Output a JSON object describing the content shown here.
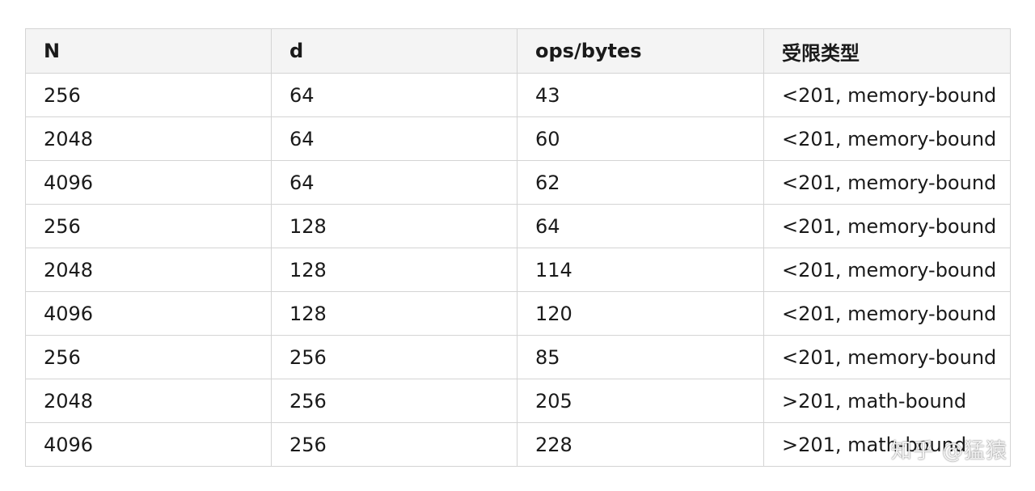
{
  "table": {
    "headers": [
      "N",
      "d",
      "ops/bytes",
      "受限类型"
    ],
    "rows": [
      [
        "256",
        "64",
        "43",
        "<201, memory-bound"
      ],
      [
        "2048",
        "64",
        "60",
        "<201, memory-bound"
      ],
      [
        "4096",
        "64",
        "62",
        "<201, memory-bound"
      ],
      [
        "256",
        "128",
        "64",
        "<201, memory-bound"
      ],
      [
        "2048",
        "128",
        "114",
        "<201, memory-bound"
      ],
      [
        "4096",
        "128",
        "120",
        "<201, memory-bound"
      ],
      [
        "256",
        "256",
        "85",
        "<201, memory-bound"
      ],
      [
        "2048",
        "256",
        "205",
        ">201, math-bound"
      ],
      [
        "4096",
        "256",
        "228",
        ">201, math-bound"
      ]
    ]
  },
  "watermark": {
    "text": "知乎 @猛猿"
  }
}
